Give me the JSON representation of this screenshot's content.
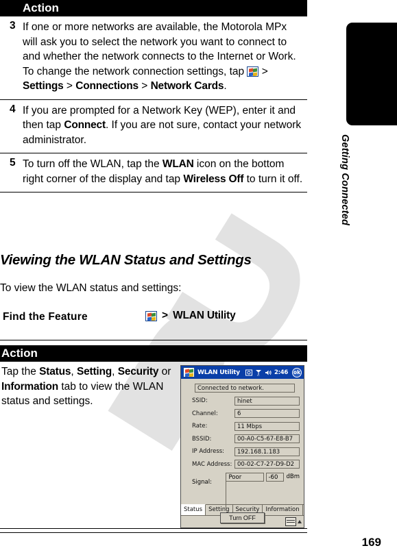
{
  "page": {
    "number": "169",
    "running_head": "Getting Connected"
  },
  "table_one": {
    "header_label": "Action",
    "rows": [
      {
        "num": "3",
        "text_a": "If one or more networks are available, the Motorola MPx will ask you to select the network you want to connect to and whether the network connects to the Internet or Work. To change the network connection settings, tap ",
        "icon": "windows-start-icon",
        "sep1": " > ",
        "ui1": "Settings",
        "sep2": " > ",
        "ui2": "Connections",
        "sep3": " > ",
        "ui3": "Network Cards",
        "text_b": "."
      },
      {
        "num": "4",
        "text_a": "If you are prompted for a Network Key (WEP), enter it and then tap ",
        "ui1": "Connect",
        "text_b": ". If you are not sure, contact your network administrator."
      },
      {
        "num": "5",
        "text_a": "To turn off the WLAN, tap the ",
        "ui1": "WLAN",
        "text_b": " icon on the bottom right corner of the display and tap ",
        "ui2": "Wireless Off",
        "text_c": " to turn it off."
      }
    ]
  },
  "section": {
    "heading": "Viewing the WLAN Status and Settings",
    "intro": "To view the WLAN status and settings:"
  },
  "find_the_feature": {
    "label": "Find the Feature",
    "icon": "windows-start-icon",
    "separator": ">",
    "target": "WLAN Utility"
  },
  "table_two": {
    "header_label": "Action",
    "body": {
      "text_a": "Tap the ",
      "ui1": "Status",
      "sep1": ", ",
      "ui2": "Setting",
      "sep2": ", ",
      "ui3": "Security",
      "text_b": " or ",
      "ui4": "Information",
      "text_c": " tab to view the WLAN status and settings."
    }
  },
  "pda_screenshot": {
    "titlebar": {
      "start_icon": "windows-start-icon",
      "title": "WLAN Utility",
      "icons": [
        "screen-capture-icon",
        "signal-icon",
        "volume-icon"
      ],
      "clock": "2:46",
      "ok_label": "ok"
    },
    "status_message": "Connected to network.",
    "fields": [
      {
        "label": "SSID:",
        "value": "hinet"
      },
      {
        "label": "Channel:",
        "value": "6"
      },
      {
        "label": "Rate:",
        "value": "11 Mbps"
      },
      {
        "label": "BSSID:",
        "value": "00-A0-C5-67-E8-B7"
      },
      {
        "label": "IP Address:",
        "value": "192.168.1.183"
      },
      {
        "label": "MAC Address:",
        "value": "00-02-C7-27-D9-D2"
      }
    ],
    "signal": {
      "label": "Signal:",
      "quality": "Poor",
      "dbm_value": "-60",
      "dbm_unit": "dBm",
      "bar_percent": 45,
      "bar_color": "#1010b4"
    },
    "turn_off_button": "Turn OFF",
    "tabs": [
      {
        "label": "Status",
        "active": true
      },
      {
        "label": "Setting",
        "active": false
      },
      {
        "label": "Security",
        "active": false
      },
      {
        "label": "Information",
        "active": false
      }
    ],
    "taskbar_icons": [
      "keyboard-icon",
      "caret-up-icon"
    ]
  }
}
